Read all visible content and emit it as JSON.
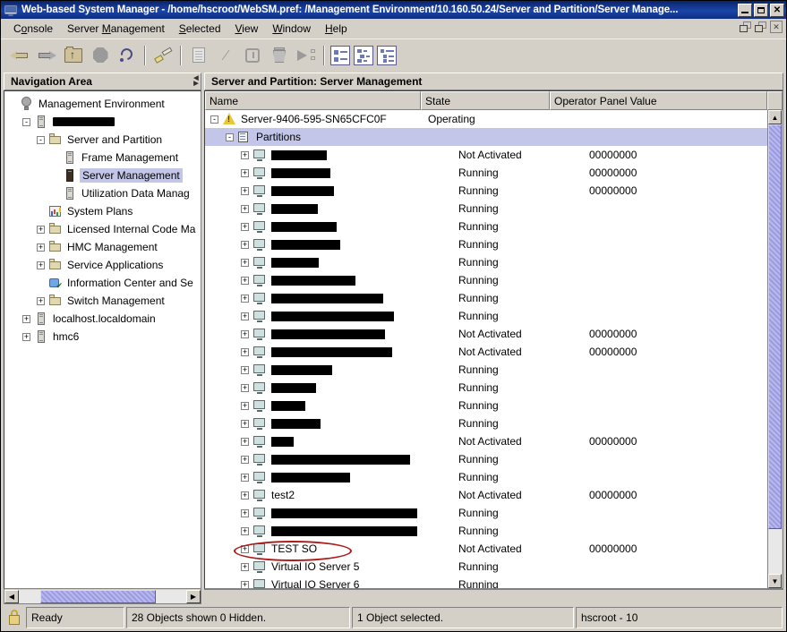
{
  "window": {
    "title": "Web-based System Manager - /home/hscroot/WebSM.pref: /Management Environment/10.160.50.24/Server and Partition/Server Manage...",
    "icon": "app-icon",
    "minimize_label": "_",
    "maximize_label": "□",
    "close_label": "✕"
  },
  "menubar": {
    "items": [
      {
        "label": "Console",
        "mnemonic": "C"
      },
      {
        "label": "Server Management",
        "mnemonic": "M"
      },
      {
        "label": "Selected",
        "mnemonic": "S"
      },
      {
        "label": "View",
        "mnemonic": "V"
      },
      {
        "label": "Window",
        "mnemonic": "W"
      },
      {
        "label": "Help",
        "mnemonic": "H"
      }
    ],
    "mdi_restore_label": "",
    "mdi_close_label": "✕"
  },
  "toolbar": {
    "buttons": [
      {
        "name": "back-icon",
        "tip": "Back"
      },
      {
        "name": "forward-icon",
        "tip": "Forward"
      },
      {
        "name": "folder-up-icon",
        "tip": "Up One Level"
      },
      {
        "name": "stop-icon",
        "tip": "Stop"
      },
      {
        "name": "reload-icon",
        "tip": "Reload"
      },
      {
        "name": "brush-icon",
        "tip": "Console Properties"
      },
      {
        "name": "document-icon",
        "tip": "Properties"
      },
      {
        "name": "percent-icon",
        "tip": "Utilization"
      },
      {
        "name": "power-icon",
        "tip": "Power On/Off"
      },
      {
        "name": "trash-icon",
        "tip": "Delete"
      },
      {
        "name": "run-icon",
        "tip": "Activate"
      },
      {
        "name": "view-large-icons-icon",
        "tip": "Large Icons"
      },
      {
        "name": "view-details-icon",
        "tip": "Details"
      },
      {
        "name": "view-tree-icon",
        "tip": "Tree Details"
      }
    ]
  },
  "navigation": {
    "title": "Navigation Area",
    "tree": [
      {
        "label": "Management Environment",
        "icon": "globe-icon",
        "indent": 0,
        "expander": "",
        "selected": false,
        "redacted": false
      },
      {
        "label": "",
        "icon": "server-icon",
        "indent": 1,
        "expander": "-",
        "selected": false,
        "redacted": true,
        "redact_width": 69
      },
      {
        "label": "Server and Partition",
        "icon": "folder-icon",
        "indent": 2,
        "expander": "-",
        "selected": false,
        "redacted": false
      },
      {
        "label": "Frame Management",
        "icon": "server-icon",
        "indent": 3,
        "expander": "",
        "selected": false,
        "redacted": false
      },
      {
        "label": "Server Management",
        "icon": "server-dark-icon",
        "indent": 3,
        "expander": "",
        "selected": true,
        "redacted": false
      },
      {
        "label": "Utilization Data Manag",
        "icon": "server-icon",
        "indent": 3,
        "expander": "",
        "selected": false,
        "redacted": false
      },
      {
        "label": "System Plans",
        "icon": "chart-icon",
        "indent": 2,
        "expander": "",
        "selected": false,
        "redacted": false
      },
      {
        "label": "Licensed Internal Code Ma",
        "icon": "folder-icon",
        "indent": 2,
        "expander": "+",
        "selected": false,
        "redacted": false
      },
      {
        "label": "HMC Management",
        "icon": "folder-icon",
        "indent": 2,
        "expander": "+",
        "selected": false,
        "redacted": false
      },
      {
        "label": "Service Applications",
        "icon": "folder-icon",
        "indent": 2,
        "expander": "+",
        "selected": false,
        "redacted": false
      },
      {
        "label": "Information Center and Se",
        "icon": "info-icon",
        "indent": 2,
        "expander": "",
        "selected": false,
        "redacted": false
      },
      {
        "label": "Switch Management",
        "icon": "folder-icon",
        "indent": 2,
        "expander": "+",
        "selected": false,
        "redacted": false
      },
      {
        "label": "localhost.localdomain",
        "icon": "server-icon",
        "indent": 1,
        "expander": "+",
        "selected": false,
        "redacted": false
      },
      {
        "label": "hmc6",
        "icon": "server-icon",
        "indent": 1,
        "expander": "+",
        "selected": false,
        "redacted": false
      }
    ],
    "hscroll": {
      "left_arrow": "◄",
      "right_arrow": "►"
    }
  },
  "content": {
    "title": "Server and Partition: Server Management",
    "columns": [
      "Name",
      "State",
      "Operator Panel Value"
    ],
    "rows": [
      {
        "name": "Server-9406-595-SN65CFC0F",
        "state": "Operating",
        "opv": "",
        "indent": 0,
        "expander": "-",
        "icon": "warning-icon",
        "selected": false,
        "redacted": false
      },
      {
        "name": "Partitions",
        "state": "",
        "opv": "",
        "indent": 1,
        "expander": "-",
        "icon": "partitions-icon",
        "selected": true,
        "redacted": false
      },
      {
        "name": "",
        "state": "Not Activated",
        "opv": "00000000",
        "indent": 2,
        "expander": "+",
        "icon": "lpar-icon",
        "selected": false,
        "redacted": true,
        "redact_width": 62
      },
      {
        "name": "",
        "state": "Running",
        "opv": "00000000",
        "indent": 2,
        "expander": "+",
        "icon": "lpar-icon",
        "selected": false,
        "redacted": true,
        "redact_width": 66
      },
      {
        "name": "",
        "state": "Running",
        "opv": "00000000",
        "indent": 2,
        "expander": "+",
        "icon": "lpar-icon",
        "selected": false,
        "redacted": true,
        "redact_width": 70
      },
      {
        "name": "",
        "state": "Running",
        "opv": "",
        "indent": 2,
        "expander": "+",
        "icon": "lpar-icon",
        "selected": false,
        "redacted": true,
        "redact_width": 52
      },
      {
        "name": "",
        "state": "Running",
        "opv": "",
        "indent": 2,
        "expander": "+",
        "icon": "lpar-icon",
        "selected": false,
        "redacted": true,
        "redact_width": 73
      },
      {
        "name": "",
        "state": "Running",
        "opv": "",
        "indent": 2,
        "expander": "+",
        "icon": "lpar-icon",
        "selected": false,
        "redacted": true,
        "redact_width": 77
      },
      {
        "name": "",
        "state": "Running",
        "opv": "",
        "indent": 2,
        "expander": "+",
        "icon": "lpar-icon",
        "selected": false,
        "redacted": true,
        "redact_width": 53
      },
      {
        "name": "",
        "state": "Running",
        "opv": "",
        "indent": 2,
        "expander": "+",
        "icon": "lpar-icon",
        "selected": false,
        "redacted": true,
        "redact_width": 94
      },
      {
        "name": "",
        "state": "Running",
        "opv": "",
        "indent": 2,
        "expander": "+",
        "icon": "lpar-icon",
        "selected": false,
        "redacted": true,
        "redact_width": 125
      },
      {
        "name": "",
        "state": "Running",
        "opv": "",
        "indent": 2,
        "expander": "+",
        "icon": "lpar-icon",
        "selected": false,
        "redacted": true,
        "redact_width": 137
      },
      {
        "name": "",
        "state": "Not Activated",
        "opv": "00000000",
        "indent": 2,
        "expander": "+",
        "icon": "lpar-icon",
        "selected": false,
        "redacted": true,
        "redact_width": 127
      },
      {
        "name": "",
        "state": "Not Activated",
        "opv": "00000000",
        "indent": 2,
        "expander": "+",
        "icon": "lpar-icon",
        "selected": false,
        "redacted": true,
        "redact_width": 135
      },
      {
        "name": "",
        "state": "Running",
        "opv": "",
        "indent": 2,
        "expander": "+",
        "icon": "lpar-icon",
        "selected": false,
        "redacted": true,
        "redact_width": 68
      },
      {
        "name": "",
        "state": "Running",
        "opv": "",
        "indent": 2,
        "expander": "+",
        "icon": "lpar-icon",
        "selected": false,
        "redacted": true,
        "redact_width": 50
      },
      {
        "name": "",
        "state": "Running",
        "opv": "",
        "indent": 2,
        "expander": "+",
        "icon": "lpar-icon",
        "selected": false,
        "redacted": true,
        "redact_width": 38
      },
      {
        "name": "",
        "state": "Running",
        "opv": "",
        "indent": 2,
        "expander": "+",
        "icon": "lpar-icon",
        "selected": false,
        "redacted": true,
        "redact_width": 55
      },
      {
        "name": "",
        "state": "Not Activated",
        "opv": "00000000",
        "indent": 2,
        "expander": "+",
        "icon": "lpar-icon",
        "selected": false,
        "redacted": true,
        "redact_width": 25
      },
      {
        "name": "",
        "state": "Running",
        "opv": "",
        "indent": 2,
        "expander": "+",
        "icon": "lpar-icon",
        "selected": false,
        "redacted": true,
        "redact_width": 155
      },
      {
        "name": "",
        "state": "Running",
        "opv": "",
        "indent": 2,
        "expander": "+",
        "icon": "lpar-icon",
        "selected": false,
        "redacted": true,
        "redact_width": 88
      },
      {
        "name": "test2",
        "state": "Not Activated",
        "opv": "00000000",
        "indent": 2,
        "expander": "+",
        "icon": "lpar-icon",
        "selected": false,
        "redacted": false
      },
      {
        "name": "",
        "state": "Running",
        "opv": "",
        "indent": 2,
        "expander": "+",
        "icon": "lpar-icon",
        "selected": false,
        "redacted": true,
        "redact_width": 163
      },
      {
        "name": "",
        "state": "Running",
        "opv": "",
        "indent": 2,
        "expander": "+",
        "icon": "lpar-icon",
        "selected": false,
        "redacted": true,
        "redact_width": 163
      },
      {
        "name": "TEST SO",
        "state": "Not Activated",
        "opv": "00000000",
        "indent": 2,
        "expander": "+",
        "icon": "lpar-icon",
        "selected": false,
        "redacted": false,
        "annotated": true
      },
      {
        "name": "Virtual IO Server 5",
        "state": "Running",
        "opv": "",
        "indent": 2,
        "expander": "+",
        "icon": "lpar-icon",
        "selected": false,
        "redacted": false
      },
      {
        "name": "Virtual IO Server 6",
        "state": "Running",
        "opv": "",
        "indent": 2,
        "expander": "+",
        "icon": "lpar-icon",
        "selected": false,
        "redacted": false
      }
    ],
    "vscroll": {
      "up_arrow": "▲",
      "down_arrow": "▼"
    }
  },
  "annotation": {
    "color": "#b01818",
    "target": "TEST SO"
  },
  "statusbar": {
    "lock_icon": "lock-icon",
    "ready": "Ready",
    "objects": "28 Objects shown 0 Hidden.",
    "selected": "1 Object selected.",
    "user": "hscroot - 10"
  }
}
